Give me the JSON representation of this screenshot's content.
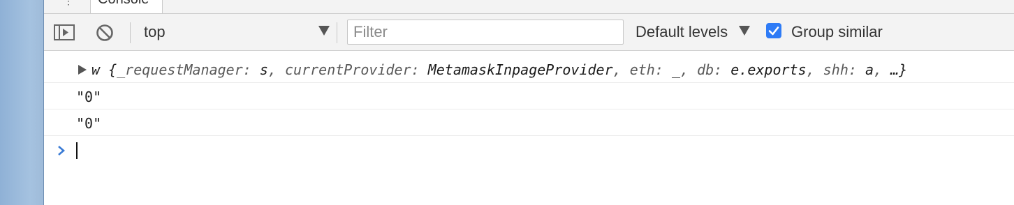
{
  "tabs": {
    "console_label": "Console"
  },
  "toolbar": {
    "context_value": "top",
    "filter_placeholder": "Filter",
    "filter_value": "",
    "levels_label": "Default levels",
    "group_similar_label": "Group similar",
    "group_similar_checked": true
  },
  "messages": [
    {
      "type": "object",
      "prefix": "w ",
      "open_brace": "{",
      "props": [
        {
          "key": "_requestManager",
          "value": "s"
        },
        {
          "key": "currentProvider",
          "value": "MetamaskInpageProvider"
        },
        {
          "key": "eth",
          "value": "_"
        },
        {
          "key": "db",
          "value": "e.exports"
        },
        {
          "key": "shh",
          "value": "a"
        }
      ],
      "ellipsis": "…",
      "close_brace": "}"
    },
    {
      "type": "string",
      "text": "\"0\""
    },
    {
      "type": "string",
      "text": "\"0\""
    }
  ],
  "colors": {
    "accent": "#2e7bf6",
    "prompt": "#3a7bd5",
    "toolbar_bg": "#f3f3f3",
    "window_strip": "#a5c2e0"
  },
  "icons": [
    "kebab-icon",
    "sidebar-toggle-icon",
    "clear-console-icon",
    "dropdown-arrow-icon",
    "checkmark-icon",
    "expand-triangle-icon",
    "prompt-chevron-icon"
  ]
}
